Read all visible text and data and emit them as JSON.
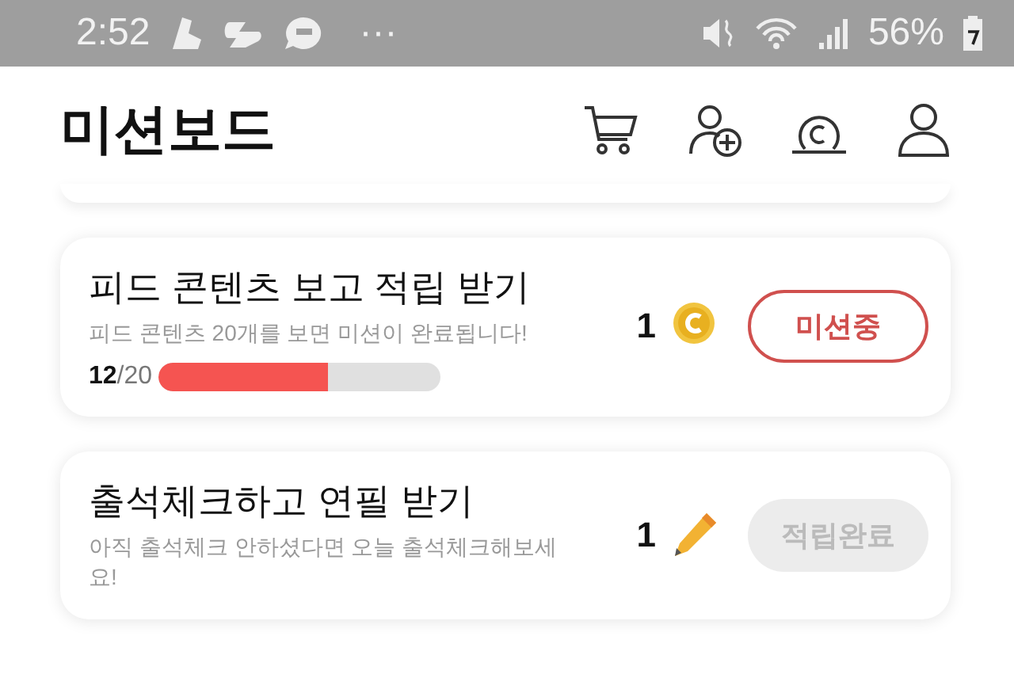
{
  "status_bar": {
    "time": "2:52",
    "more": "···",
    "battery": "56%"
  },
  "header": {
    "title": "미션보드"
  },
  "missions": [
    {
      "title": "피드 콘텐츠 보고 적립 받기",
      "description": "피드 콘텐츠 20개를 보면 미션이 완료됩니다!",
      "reward_amount": "1",
      "kind": "coin",
      "progress": {
        "text": "**12**/20",
        "level": 0.6
      },
      "button": {
        "label": "미션중",
        "completed": false
      }
    },
    {
      "title": "출석체크하고 연필 받기",
      "description": "아직 출석체크 안하셨다면 오늘 출석체크해보세요!",
      "reward_amount": "1",
      "kind": "pencil",
      "button": {
        "label": "적립완료",
        "completed": true
      }
    }
  ]
}
